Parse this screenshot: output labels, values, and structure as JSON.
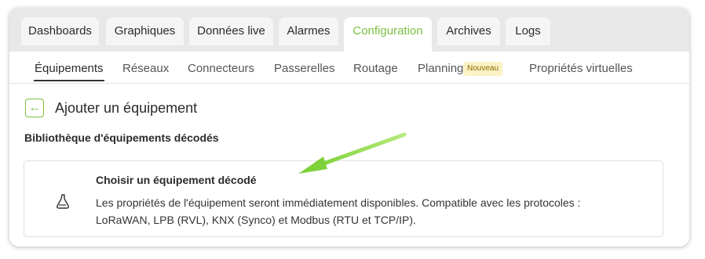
{
  "tabs": [
    {
      "label": "Dashboards"
    },
    {
      "label": "Graphiques"
    },
    {
      "label": "Données live"
    },
    {
      "label": "Alarmes"
    },
    {
      "label": "Configuration",
      "active": true
    },
    {
      "label": "Archives"
    },
    {
      "label": "Logs"
    }
  ],
  "subtabs": [
    {
      "label": "Équipements",
      "active": true
    },
    {
      "label": "Réseaux"
    },
    {
      "label": "Connecteurs"
    },
    {
      "label": "Passerelles"
    },
    {
      "label": "Routage"
    },
    {
      "label": "Planning",
      "badge": "Nouveau"
    },
    {
      "label": "Propriétés virtuelles"
    }
  ],
  "page": {
    "back_icon": "arrow-left-icon",
    "title": "Ajouter un équipement"
  },
  "library": {
    "section_title": "Bibliothèque d'équipements décodés",
    "card": {
      "icon": "bottle-icon",
      "title": "Choisir un équipement décodé",
      "desc_line1": "Les propriétés de l'équipement seront immédiatement disponibles. Compatible avec les protocoles :",
      "desc_line2": "LoRaWAN, LPB (RVL), KNX (Synco) et Modbus (RTU et TCP/IP)."
    }
  },
  "colors": {
    "accent": "#7bc143",
    "highlight": "#8bd13e",
    "badge_bg": "#fbf2c6"
  }
}
